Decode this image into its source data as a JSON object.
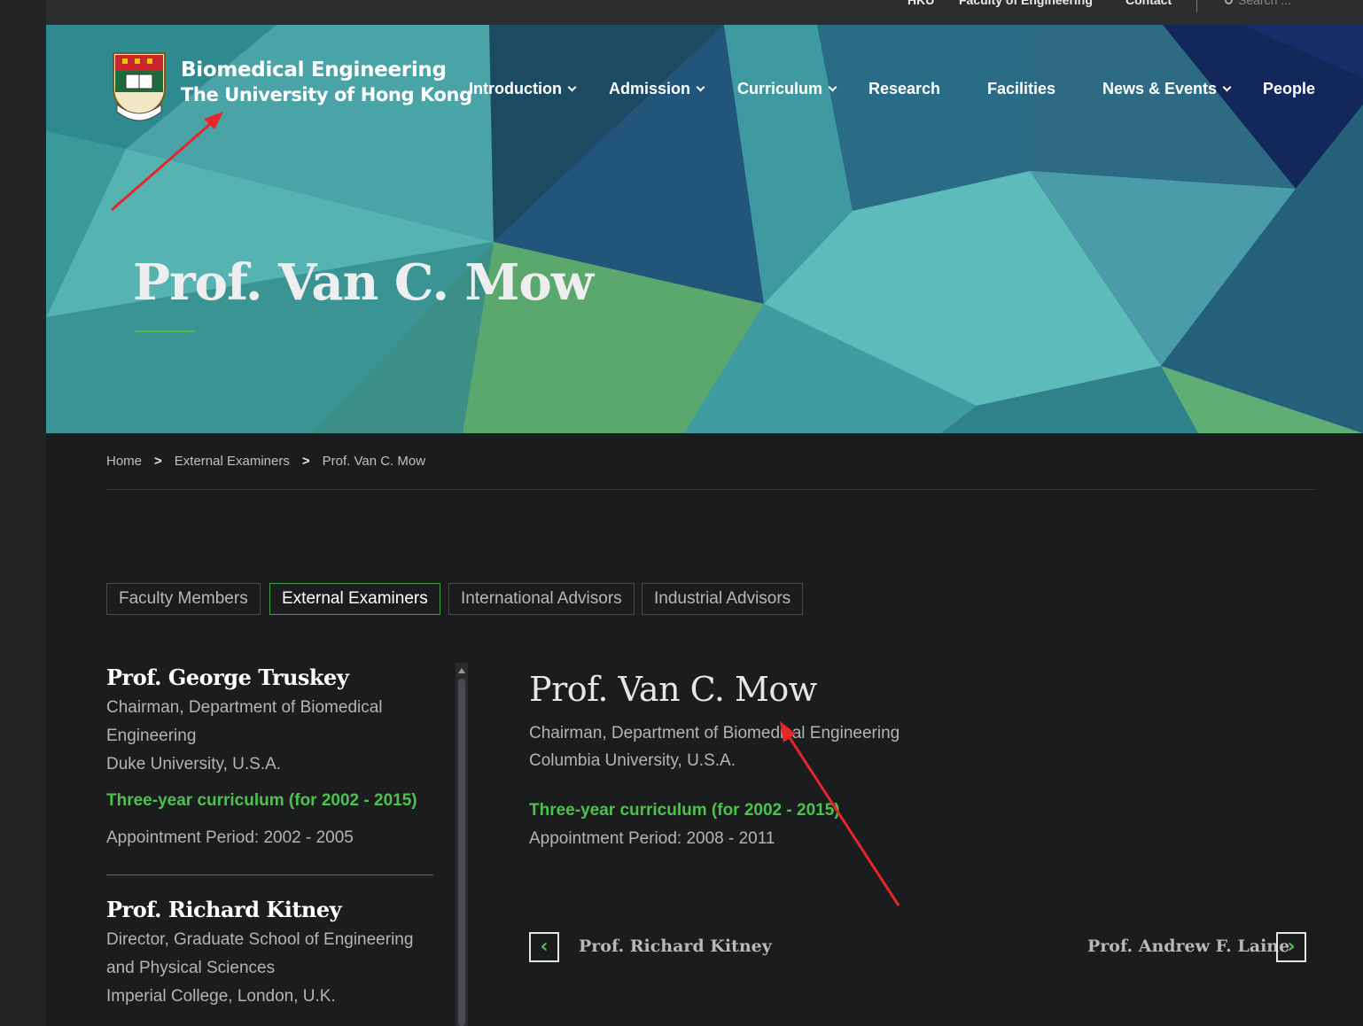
{
  "topbar": {
    "links": [
      "HKU",
      "Faculty of Engineering",
      "Contact"
    ],
    "search_placeholder": "Search ..."
  },
  "brand": {
    "line1": "Biomedical Engineering",
    "line2": "The University of Hong Kong"
  },
  "nav": {
    "items": [
      {
        "label": "Introduction",
        "has_dropdown": true
      },
      {
        "label": "Admission",
        "has_dropdown": true
      },
      {
        "label": "Curriculum",
        "has_dropdown": true
      },
      {
        "label": "Research",
        "has_dropdown": false
      },
      {
        "label": "Facilities",
        "has_dropdown": false
      },
      {
        "label": "News & Events",
        "has_dropdown": true
      },
      {
        "label": "People",
        "has_dropdown": false
      }
    ]
  },
  "hero": {
    "title": "Prof. Van C. Mow"
  },
  "breadcrumb": {
    "items": [
      "Home",
      "External Examiners",
      "Prof. Van C. Mow"
    ],
    "separator": ">"
  },
  "tabs": [
    {
      "label": "Faculty Members",
      "active": false
    },
    {
      "label": "External Examiners",
      "active": true
    },
    {
      "label": "International Advisors",
      "active": false
    },
    {
      "label": "Industrial Advisors",
      "active": false
    }
  ],
  "list": [
    {
      "name": "Prof. George Truskey",
      "lines": [
        "Chairman, Department of Biomedical",
        "Engineering",
        "Duke University, U.S.A."
      ],
      "curriculum": "Three-year curriculum (for 2002 - 2015)",
      "appointment": "Appointment Period: 2002 - 2005"
    },
    {
      "name": "Prof. Richard Kitney",
      "lines": [
        "Director, Graduate School of Engineering",
        "and Physical Sciences",
        "Imperial College, London, U.K."
      ]
    }
  ],
  "detail": {
    "name": "Prof. Van C. Mow",
    "lines": [
      "Chairman, Department of Biomedical Engineering",
      "Columbia University, U.S.A."
    ],
    "curriculum": "Three-year curriculum (for 2002 - 2015)",
    "appointment": "Appointment Period: 2008 - 2011"
  },
  "pager": {
    "prev_label": "Prof. Richard Kitney",
    "next_label": "Prof. Andrew F. Laine",
    "prev_icon": "‹",
    "next_icon": "›"
  },
  "colors": {
    "accent_green": "#4cc24d",
    "background": "#1b1c1e",
    "hero_teal": "#2e7e87",
    "annotation_red": "#e8262a"
  }
}
